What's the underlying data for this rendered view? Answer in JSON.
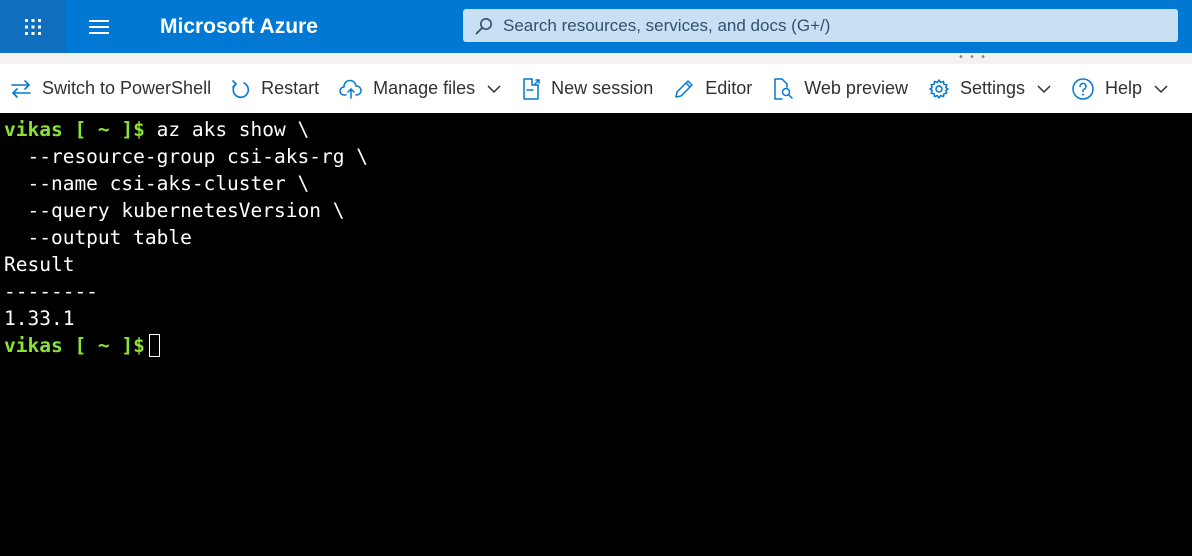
{
  "header": {
    "app_name": "Microsoft Azure",
    "search_placeholder": "Search resources, services, and docs (G+/)",
    "icons": [
      "app-launcher-icon",
      "menu-icon",
      "search-icon"
    ],
    "colors": {
      "header_bg": "#0078d4",
      "launcher_bg": "#106ebe",
      "search_bg": "#c7e0f4"
    }
  },
  "toolbar": {
    "switch_label": "Switch to PowerShell",
    "restart_label": "Restart",
    "manage_files_label": "Manage files",
    "new_session_label": "New session",
    "editor_label": "Editor",
    "web_preview_label": "Web preview",
    "settings_label": "Settings",
    "help_label": "Help"
  },
  "terminal": {
    "prompt": "vikas [ ~ ]$",
    "command": " az aks show \\",
    "continuation": [
      "  --resource-group csi-aks-rg \\",
      "  --name csi-aks-cluster \\",
      "  --query kubernetesVersion \\",
      "  --output table"
    ],
    "output": [
      "Result",
      "--------",
      "1.33.1"
    ],
    "colors": {
      "prompt": "#8ae234",
      "text": "#ffffff",
      "background": "#000000"
    }
  }
}
